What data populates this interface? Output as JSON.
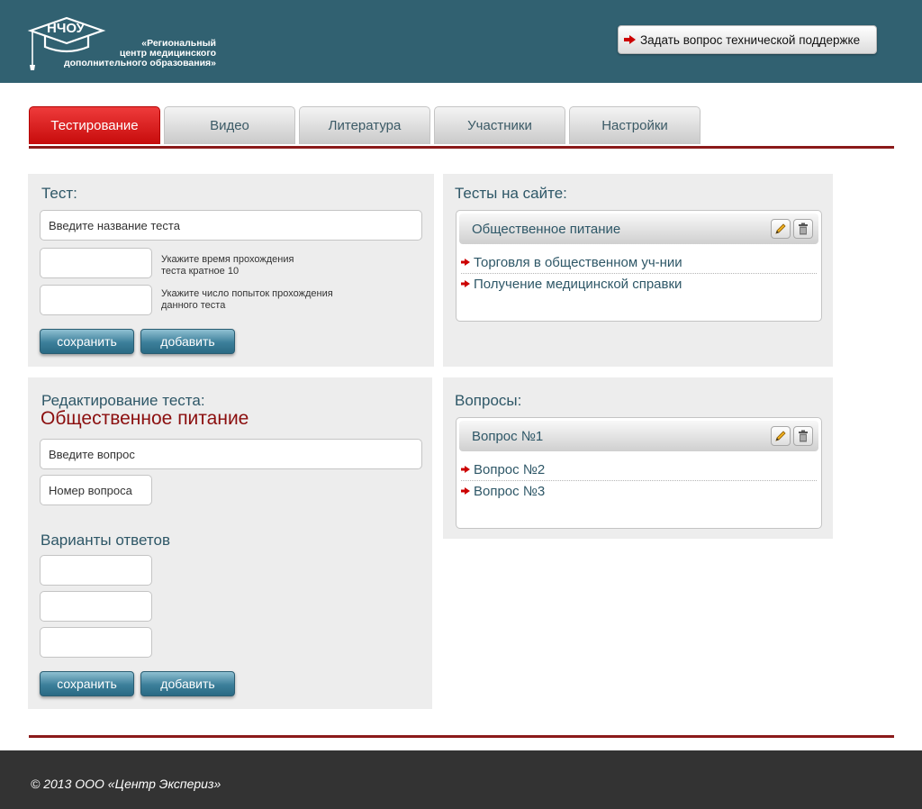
{
  "header": {
    "logo_abbr": "НЧОУ",
    "logo_line1": "«Региональный",
    "logo_line2": "центр медицинского",
    "logo_line3": "дополнительного образования»",
    "support_label": "Задать вопрос технической поддержке",
    "support_icon": "arrow-right-icon"
  },
  "tabs": [
    {
      "label": "Тестирование",
      "active": true
    },
    {
      "label": "Видео",
      "active": false
    },
    {
      "label": "Литература",
      "active": false
    },
    {
      "label": "Участники",
      "active": false
    },
    {
      "label": "Настройки",
      "active": false
    }
  ],
  "test_form": {
    "title": "Тест:",
    "name_placeholder": "Введите название теста",
    "time_hint_line1": "Укажите время прохождения",
    "time_hint_line2": "теста кратное 10",
    "attempts_hint_line1": "Укажите число попыток прохождения",
    "attempts_hint_line2": "данного теста",
    "save_label": "сохранить",
    "add_label": "добавить"
  },
  "tests_on_site": {
    "title": "Тесты на сайте:",
    "selected": "Общественное питание",
    "items": [
      "Торговля в общественном уч-нии",
      "Получение медицинской справки"
    ]
  },
  "edit_form": {
    "title": "Редактирование теста:",
    "test_name": "Общественное питание",
    "question_placeholder": "Введите вопрос",
    "number_placeholder": "Номер вопроса",
    "answers_title": "Варианты ответов",
    "save_label": "сохранить",
    "add_label": "добавить"
  },
  "questions": {
    "title": "Вопросы:",
    "selected": "Вопрос №1",
    "items": [
      "Вопрос №2",
      "Вопрос №3"
    ]
  },
  "footer": {
    "copyright": "© 2013 ООО «Центр Экспериз»"
  },
  "colors": {
    "header_bg": "#316171",
    "accent_red": "#8b1a1a",
    "tab_active": "#e02020",
    "text_teal": "#2e5767",
    "footer_bg": "#333333"
  }
}
